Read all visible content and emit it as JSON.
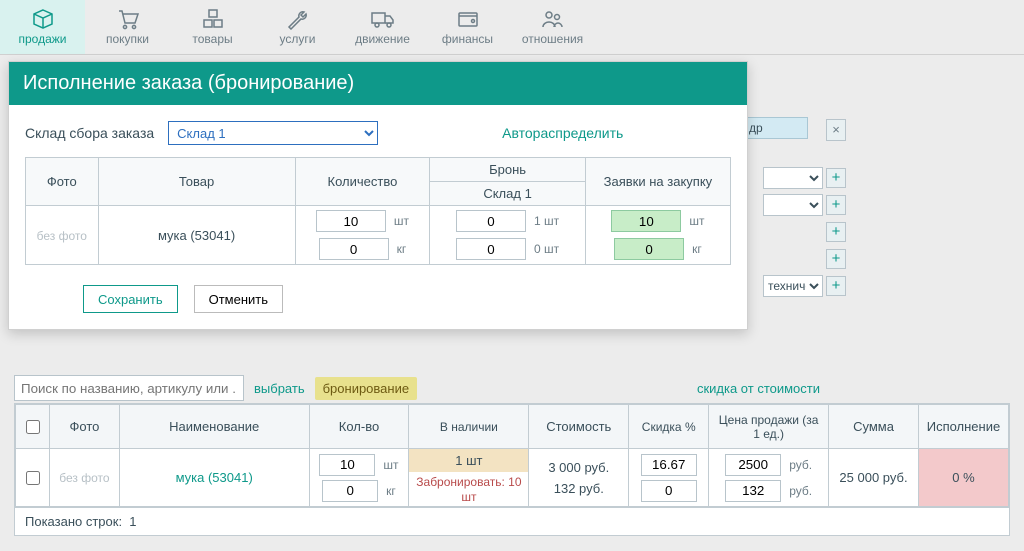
{
  "nav": {
    "items": [
      {
        "label": "продажи"
      },
      {
        "label": "покупки"
      },
      {
        "label": "товары"
      },
      {
        "label": "услуги"
      },
      {
        "label": "движение"
      },
      {
        "label": "финансы"
      },
      {
        "label": "отношения"
      }
    ]
  },
  "bg": {
    "pill": "др",
    "select_trailing": "техниче",
    "close_x": "×",
    "plus": "+"
  },
  "search": {
    "placeholder": "Поиск по названию, артикулу или ...",
    "select_label": "выбрать",
    "reserve_label": "бронирование",
    "discount_link": "скидка от стоимости"
  },
  "grid": {
    "headers": {
      "photo": "Фото",
      "name": "Наименование",
      "qty": "Кол-во",
      "stock": "В наличии",
      "cost": "Стоимость",
      "discount": "Скидка %",
      "price": "Цена продажи (за 1 ед.)",
      "sum": "Сумма",
      "exec": "Исполнение"
    },
    "row": {
      "nofoto": "без фото",
      "name": "мука (53041)",
      "qty1": "10",
      "unit1": "шт",
      "qty2": "0",
      "unit2": "кг",
      "stock_line1": "1 шт",
      "stock_line2": "Забронировать: 10 шт",
      "cost_line1": "3 000 руб.",
      "cost_line2": "132 руб.",
      "disc1": "16.67",
      "disc2": "0",
      "price1": "2500",
      "price_u1": "руб.",
      "price2": "132",
      "price_u2": "руб.",
      "sum": "25 000 руб.",
      "exec": "0 %"
    },
    "footer_label": "Показано строк:",
    "footer_count": "1"
  },
  "modal": {
    "title": "Исполнение заказа (бронирование)",
    "store_label": "Склад сбора заказа",
    "store_value": "Склад 1",
    "auto": "Автораспределить",
    "headers": {
      "photo": "Фото",
      "item": "Товар",
      "qty": "Количество",
      "reserve": "Бронь",
      "reserve_sub": "Склад 1",
      "request": "Заявки на закупку"
    },
    "row": {
      "nofoto": "без фото",
      "item": "мука (53041)",
      "q1": "10",
      "u1": "шт",
      "r1": "0",
      "r1_avail": "1 шт",
      "req1": "10",
      "req_u1": "шт",
      "q2": "0",
      "u2": "кг",
      "r2": "0",
      "r2_avail": "0 шт",
      "req2": "0",
      "req_u2": "кг"
    },
    "save": "Сохранить",
    "cancel": "Отменить"
  }
}
